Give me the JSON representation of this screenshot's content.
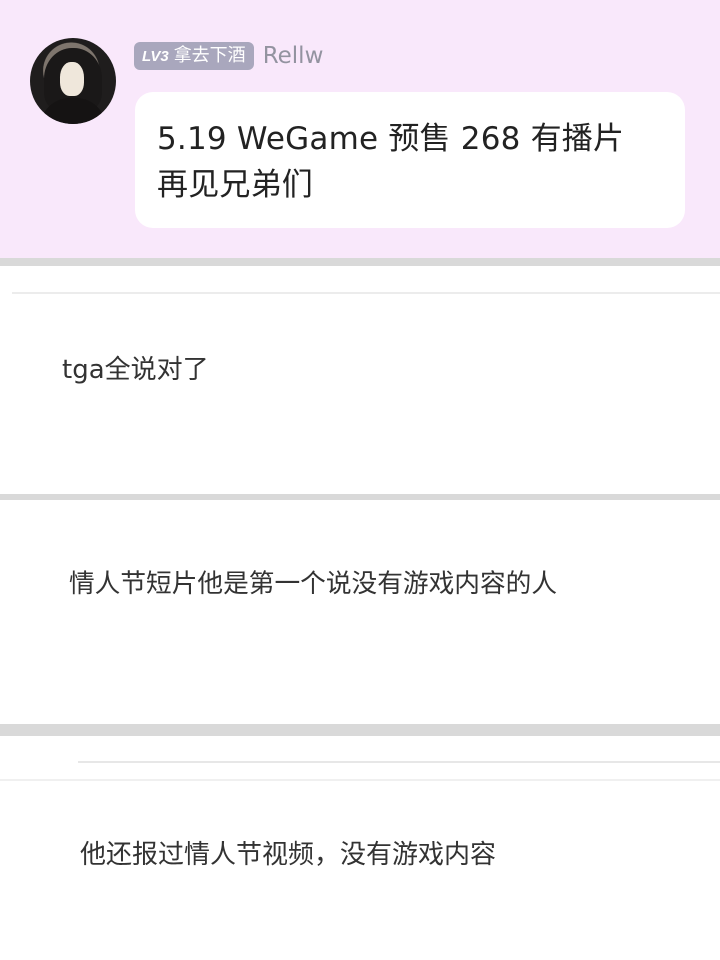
{
  "chat": {
    "level_badge": "LV3",
    "level_name": "拿去下酒",
    "username": "Rellw",
    "message": "5.19 WeGame 预售 268 有播片 再见兄弟们"
  },
  "comments": [
    {
      "text": "tga全说对了"
    },
    {
      "text": "情人节短片他是第一个说没有游戏内容的人"
    },
    {
      "text": "他还报过情人节视频，没有游戏内容"
    }
  ]
}
